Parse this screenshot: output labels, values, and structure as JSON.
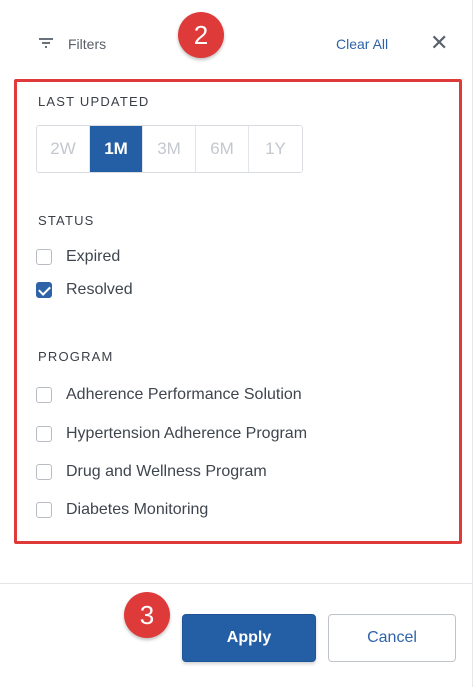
{
  "header": {
    "title": "Filters",
    "clear_all": "Clear All",
    "close_icon": "close-icon",
    "filter_icon": "filter-icon"
  },
  "annotations": {
    "marker_2": "2",
    "marker_3": "3",
    "marker_color": "#df3a3a"
  },
  "last_updated": {
    "title": "LAST UPDATED",
    "options": [
      {
        "label": "2W",
        "selected": false
      },
      {
        "label": "1M",
        "selected": true
      },
      {
        "label": "3M",
        "selected": false
      },
      {
        "label": "6M",
        "selected": false
      },
      {
        "label": "1Y",
        "selected": false
      }
    ]
  },
  "status": {
    "title": "STATUS",
    "options": [
      {
        "label": "Expired",
        "checked": false
      },
      {
        "label": "Resolved",
        "checked": true
      }
    ]
  },
  "program": {
    "title": "PROGRAM",
    "options": [
      {
        "label": "Adherence Performance Solution",
        "checked": false
      },
      {
        "label": "Hypertension Adherence Program",
        "checked": false
      },
      {
        "label": "Drug and Wellness Program",
        "checked": false
      },
      {
        "label": "Diabetes Monitoring",
        "checked": false
      }
    ]
  },
  "footer": {
    "apply_label": "Apply",
    "cancel_label": "Cancel"
  },
  "colors": {
    "primary": "#245ea5",
    "link": "#2f63a8"
  }
}
